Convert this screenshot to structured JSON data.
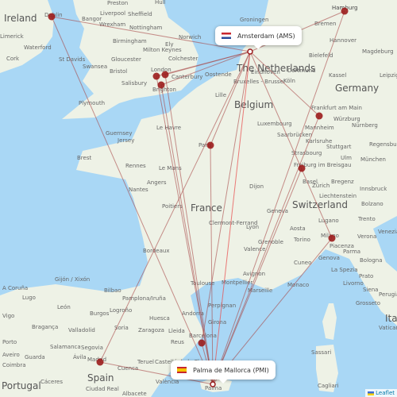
{
  "map": {
    "hub_popups": [
      {
        "label": "Amsterdam (AMS)",
        "flag": "netherlands-flag"
      },
      {
        "label": "Palma de Mallorca (PMI)",
        "flag": "spain-flag"
      }
    ],
    "countries": [
      "Ireland",
      "The Netherlands",
      "Belgium",
      "Germany",
      "France",
      "Switzerland",
      "Spain",
      "Portugal",
      "Ital"
    ],
    "cities": [
      "Dublin",
      "Preston",
      "Hull",
      "Liverpool",
      "Sheffield",
      "Bangor",
      "Wrexham",
      "Nottingham",
      "Norwich",
      "Birmingham",
      "Ely",
      "Limerick",
      "Waterford",
      "Cork",
      "Milton Keynes",
      "St Davids",
      "Gloucester",
      "Colchester",
      "Swansea",
      "Bristol",
      "London",
      "Canterbury",
      "Salisbury",
      "Brighton",
      "Plymouth",
      "Le Havre",
      "Guernsey",
      "Jersey",
      "Brest",
      "Rennes",
      "Le Mans",
      "Angers",
      "Nantes",
      "Groningen",
      "Bremen",
      "Hannover",
      "Magdeburg",
      "Bielefeld",
      "Dortmund",
      "Eindhoven",
      "Oostende",
      "Bruxelles - Brussel",
      "Lille",
      "Köln",
      "Kassel",
      "Leipzig",
      "Frankfurt am Main",
      "Würzburg",
      "Luxembourg",
      "Nürnberg",
      "Mannheim",
      "Saarbrücken",
      "Karlsruhe",
      "Stuttgart",
      "Regensburg",
      "Paris",
      "Strasbourg",
      "Ulm",
      "München",
      "Freiburg im Breisgau",
      "Dijon",
      "Basel",
      "Zürich",
      "Bregenz",
      "Innsbruck",
      "Liechtenstein",
      "Poitiers",
      "Bordeaux",
      "Geneva",
      "Clermont-Ferrand",
      "Lyon",
      "Aosta",
      "Lugano",
      "Bolzano",
      "Trento",
      "Milano",
      "Verona",
      "Venezia",
      "Torino",
      "Grenoble",
      "Valence",
      "Piacenza",
      "Parma",
      "Genova",
      "Cuneo",
      "Bologna",
      "La Spezia",
      "Avignon",
      "Montpellier",
      "Marseille",
      "Monaco",
      "Livorno",
      "Prato",
      "Siena",
      "Perugia",
      "Grosseto",
      "Toulouse",
      "Perpignan",
      "Andorra",
      "Girona",
      "Barcelona",
      "Vatican",
      "Gijón / Xixón",
      "A Coruña",
      "Bilbao",
      "Lugo",
      "Pamplona/Iruña",
      "León",
      "Logroño",
      "Burgos",
      "Vigo",
      "Huesca",
      "Bragança",
      "Valladolid",
      "Soria",
      "Zaragoza",
      "Lleida",
      "Porto",
      "Salamanca",
      "Segovia",
      "Reus",
      "Aveiro",
      "Guarda",
      "Ávila",
      "Madrid",
      "Teruel",
      "Castelló de la Plana",
      "Coimbra",
      "Cuenca",
      "Cáceres",
      "València",
      "Ciudad Real",
      "Albacete",
      "Sassari",
      "Cagliari",
      "Palma"
    ],
    "routes": [
      {
        "from": "Palma de Mallorca",
        "to": "Dublin"
      },
      {
        "from": "Palma de Mallorca",
        "to": "London"
      },
      {
        "from": "Palma de Mallorca",
        "to": "London"
      },
      {
        "from": "Palma de Mallorca",
        "to": "Brighton"
      },
      {
        "from": "Palma de Mallorca",
        "to": "Paris"
      },
      {
        "from": "Palma de Mallorca",
        "to": "Hamburg"
      },
      {
        "from": "Palma de Mallorca",
        "to": "Frankfurt am Main"
      },
      {
        "from": "Palma de Mallorca",
        "to": "Basel"
      },
      {
        "from": "Palma de Mallorca",
        "to": "Milano"
      },
      {
        "from": "Palma de Mallorca",
        "to": "Barcelona"
      },
      {
        "from": "Palma de Mallorca",
        "to": "Madrid"
      },
      {
        "from": "Palma de Mallorca",
        "to": "Amsterdam"
      },
      {
        "from": "Amsterdam",
        "to": "Dublin"
      },
      {
        "from": "Amsterdam",
        "to": "London"
      },
      {
        "from": "Amsterdam",
        "to": "London"
      },
      {
        "from": "Amsterdam",
        "to": "Brighton"
      },
      {
        "from": "Amsterdam",
        "to": "Paris"
      },
      {
        "from": "Amsterdam",
        "to": "Hamburg"
      },
      {
        "from": "Amsterdam",
        "to": "Frankfurt am Main"
      },
      {
        "from": "Amsterdam",
        "to": "Milano"
      },
      {
        "from": "Amsterdam",
        "to": "Madrid"
      },
      {
        "from": "Amsterdam",
        "to": "Barcelona"
      }
    ],
    "colors": {
      "route": "#a84848",
      "airport": "#9b1c1c",
      "sea": "#a9d7f5",
      "land": "#eef2e6"
    },
    "attribution": "Leaflet"
  }
}
